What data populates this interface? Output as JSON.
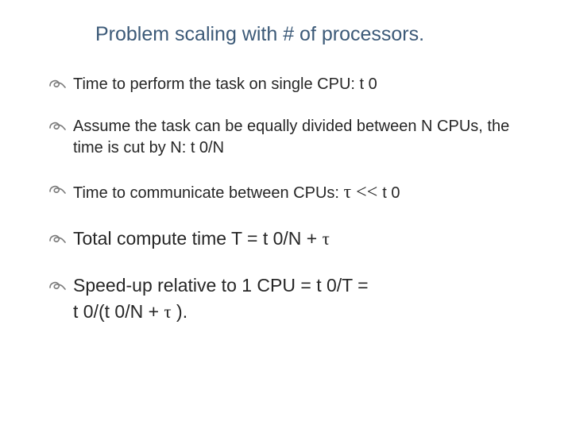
{
  "title": "Problem scaling with # of processors.",
  "bullets": {
    "b1": "Time to perform the task on single CPU: t 0",
    "b2": "Assume the task can be equally divided between N CPUs,  the time is cut by N:  t 0/N",
    "b3_pre": "Time to communicate between CPUs: ",
    "b3_tau": "τ",
    "b3_ll": " << ",
    "b3_post": "t 0",
    "b4_pre": "Total compute time T = t 0/N + ",
    "b4_tau": "τ",
    "b5_line1": "Speed-up relative to 1 CPU = t 0/T =",
    "b5_line2_pre": "t 0/(t 0/N + ",
    "b5_line2_tau": "τ",
    "b5_line2_post": " )."
  }
}
